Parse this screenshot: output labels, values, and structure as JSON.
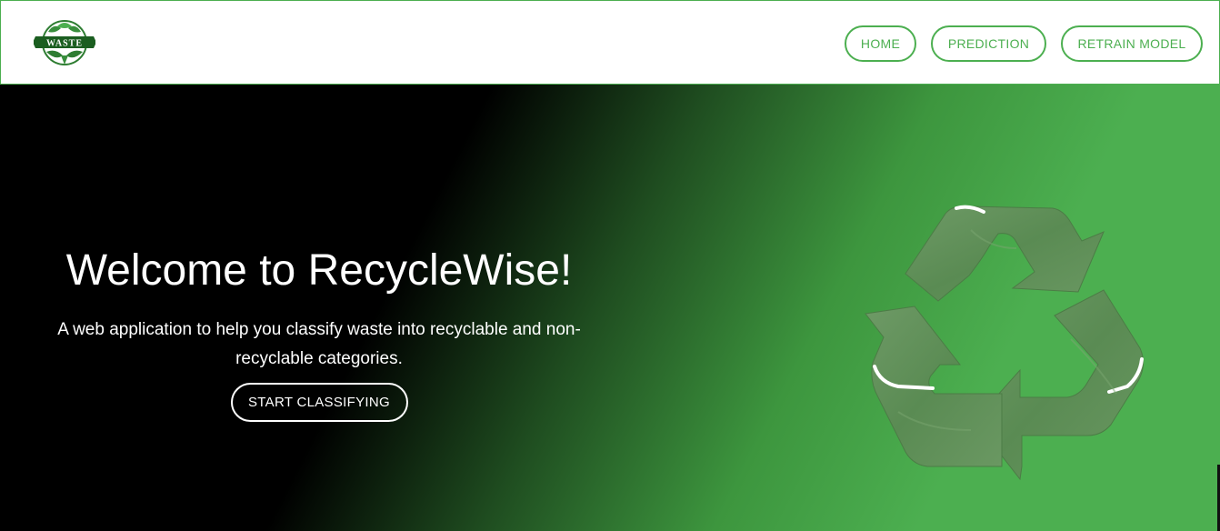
{
  "app": {
    "logo_text": "WASTE",
    "brand_color": "#4caf50"
  },
  "nav": {
    "items": [
      {
        "label": "HOME"
      },
      {
        "label": "PREDICTION"
      },
      {
        "label": "RETRAIN MODEL"
      }
    ]
  },
  "hero": {
    "title": "Welcome to RecycleWise!",
    "subtitle": "A web application to help you classify waste into recyclable and non-recyclable categories.",
    "cta_label": "START CLASSIFYING",
    "image_icon": "recycle-symbol-icon",
    "gradient_colors": [
      "#000000",
      "#4caf50"
    ]
  }
}
